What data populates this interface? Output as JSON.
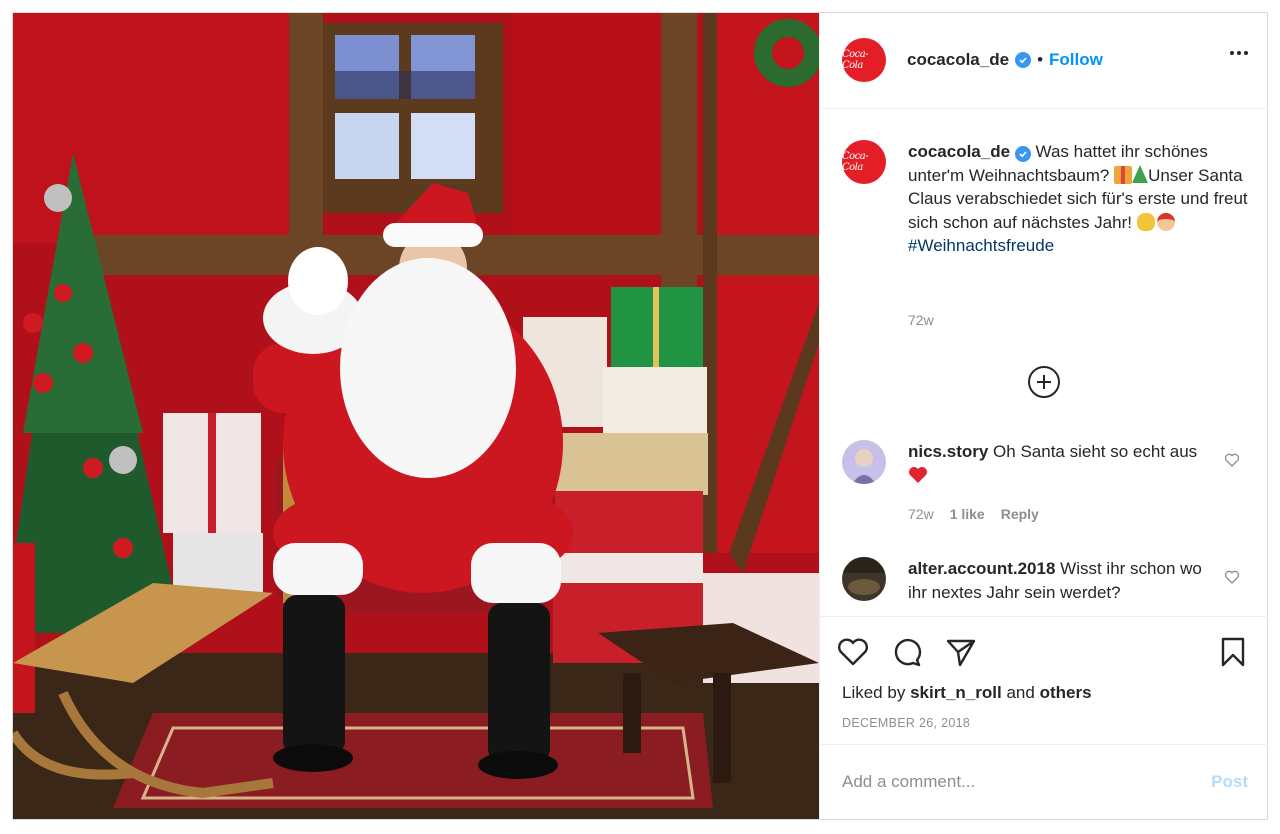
{
  "photo": {
    "alt_subject": "Santa Claus waving in a decorated Christmas room"
  },
  "header": {
    "username": "cocacola_de",
    "separator": "•",
    "follow_label": "Follow",
    "brand_logo_text": "Coca-Cola"
  },
  "caption": {
    "username": "cocacola_de",
    "text_part1": "Was hattet ihr schönes unter'm Weihnachtsbaum?",
    "text_part2": "Unser Santa Claus verabschiedet sich für's erste und freut sich schon auf nächstes Jahr!",
    "hashtag": "#Weihnachtsfreude",
    "time": "72w"
  },
  "comments": [
    {
      "username": "nics.story",
      "text": "Oh Santa sieht so echt aus",
      "time": "72w",
      "likes": "1 like",
      "reply_label": "Reply"
    },
    {
      "username": "alter.account.2018",
      "text": "Wisst ihr schon wo ihr nextes Jahr sein werdet?"
    }
  ],
  "likes": {
    "prefix": "Liked by",
    "user": "skirt_n_roll",
    "and": "and",
    "others": "others"
  },
  "date": "DECEMBER 26, 2018",
  "add_comment": {
    "placeholder": "Add a comment...",
    "post_label": "Post"
  },
  "colors": {
    "brand_red": "#e41e26",
    "link_blue": "#0095f6",
    "hashtag": "#00376b",
    "muted": "#8e8e8e",
    "post_disabled": "#b3dbff"
  }
}
